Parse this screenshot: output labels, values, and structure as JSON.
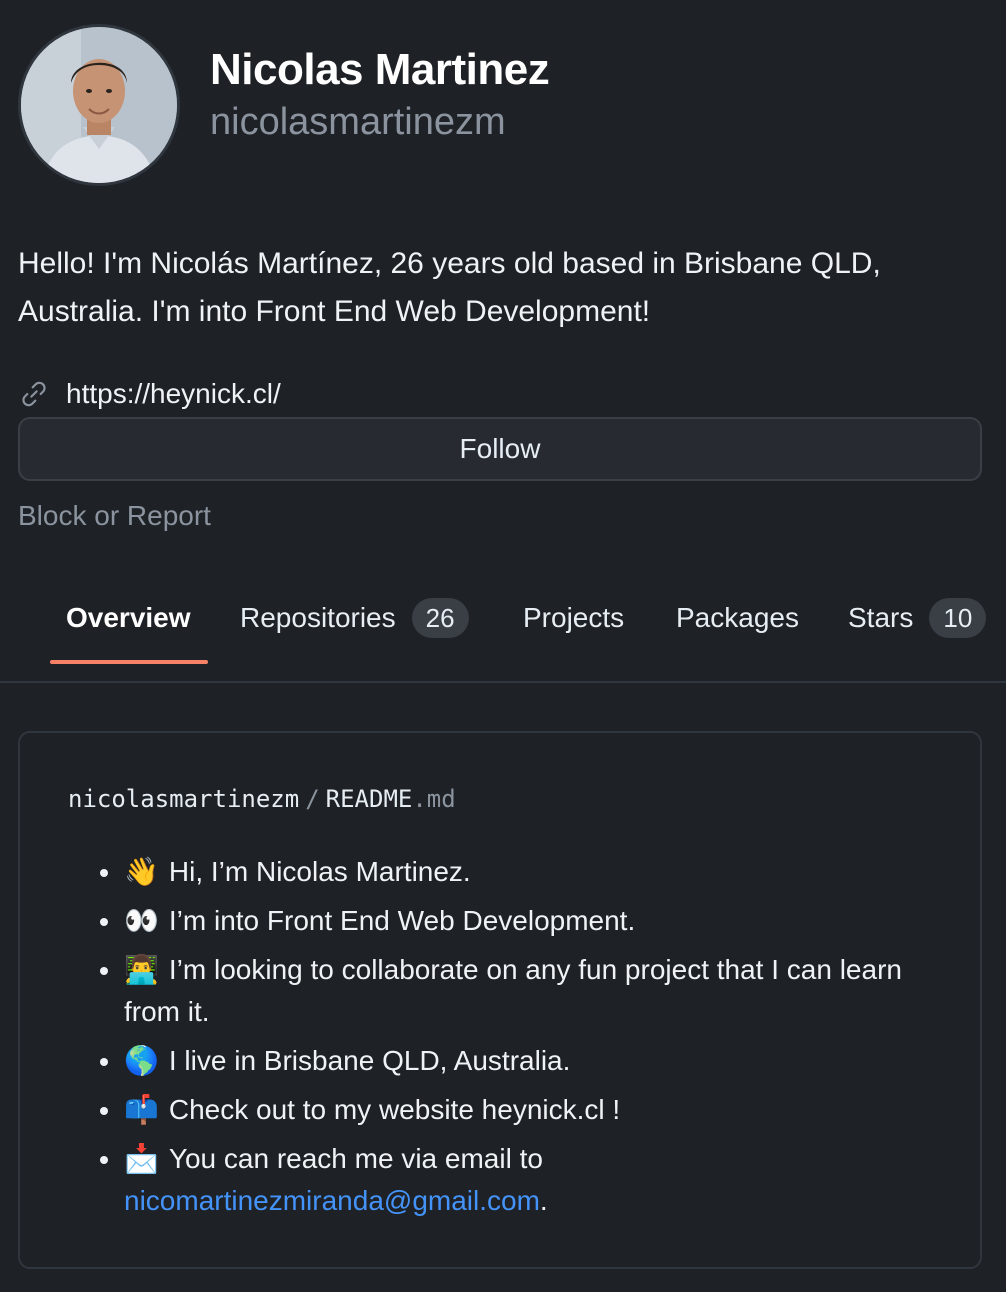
{
  "profile": {
    "full_name": "Nicolas Martinez",
    "username": "nicolasmartinezm",
    "bio": "Hello! I'm Nicolás Martínez, 26 years old based in Brisbane QLD, Australia. I'm into Front End Web Development!",
    "website": "https://heynick.cl/",
    "follow_label": "Follow",
    "block_report_label": "Block or Report"
  },
  "tabs": [
    {
      "label": "Overview",
      "active": true
    },
    {
      "label": "Repositories",
      "count": "26"
    },
    {
      "label": "Projects"
    },
    {
      "label": "Packages"
    },
    {
      "label": "Stars",
      "count": "10"
    }
  ],
  "readme": {
    "owner": "nicolasmartinezm",
    "separator": "/",
    "filename": "README",
    "extension": ".md",
    "items": [
      {
        "emoji": "👋",
        "text": "Hi, I’m Nicolas Martinez."
      },
      {
        "emoji": "👀",
        "text": "I’m into Front End Web Development."
      },
      {
        "emoji": "👨‍💻",
        "text": "I’m looking to collaborate on any fun project that I can learn from it."
      },
      {
        "emoji": "🌎",
        "text": "I live in Brisbane QLD, Australia."
      },
      {
        "emoji": "📫",
        "text": "Check out to my website heynick.cl !"
      },
      {
        "emoji": "📩",
        "text": "You can reach me via email to",
        "email": "nicomartinezmiranda@gmail.com",
        "suffix": "."
      }
    ]
  },
  "colors": {
    "background": "#1e2126",
    "accent_underline": "#f78166",
    "link": "#4493f8",
    "muted": "#8b949e"
  }
}
